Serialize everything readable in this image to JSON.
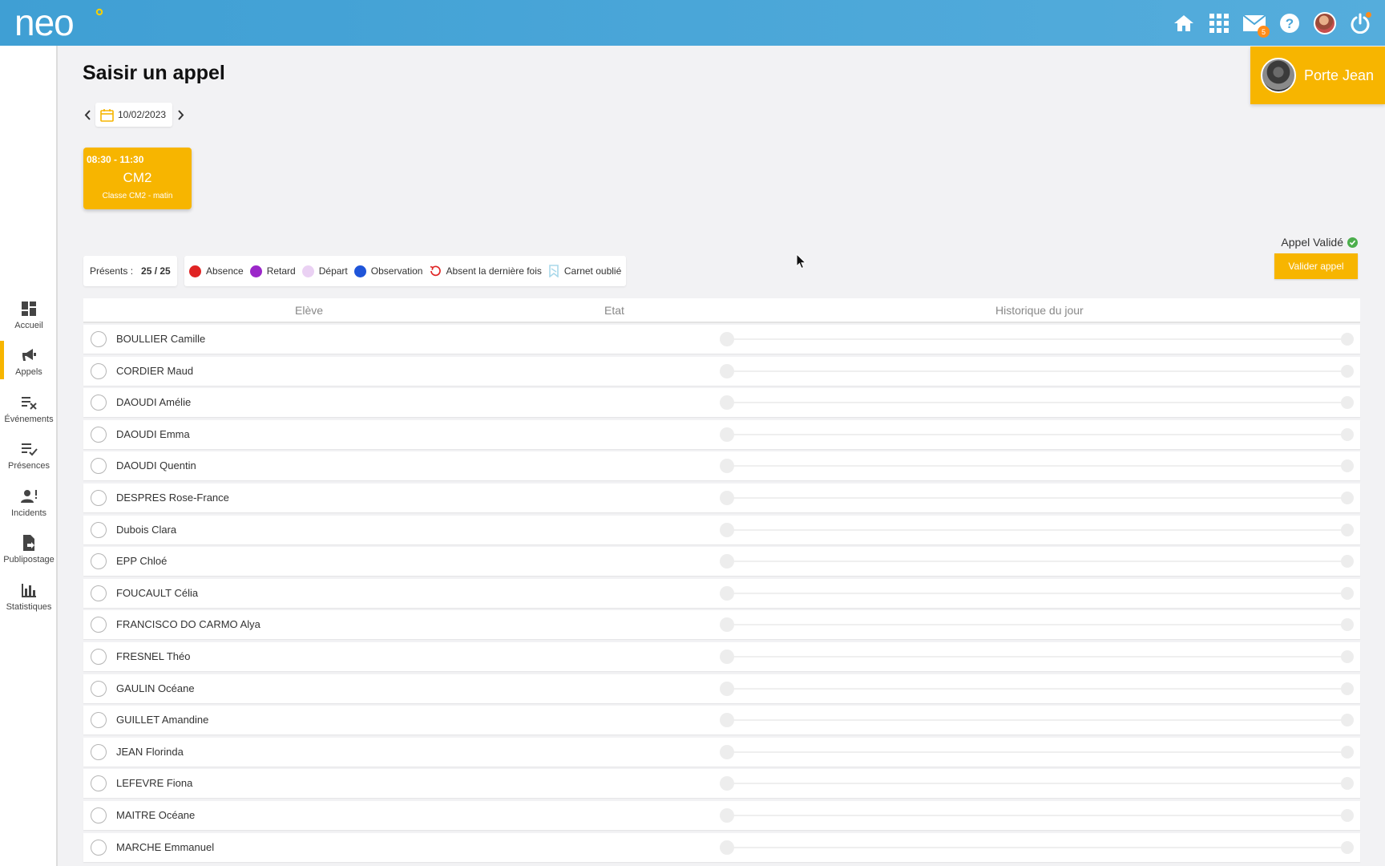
{
  "header": {
    "logo_text": "neo",
    "mail_badge": "5",
    "icons": [
      "home-icon",
      "apps-grid-icon",
      "mail-icon",
      "help-icon",
      "user-avatar",
      "power-icon"
    ]
  },
  "user": {
    "name": "Porte Jean"
  },
  "sidebar": {
    "items": [
      {
        "label": "Accueil",
        "icon": "dashboard-icon"
      },
      {
        "label": "Appels",
        "icon": "megaphone-icon"
      },
      {
        "label": "Événements",
        "icon": "list-x-icon"
      },
      {
        "label": "Présences",
        "icon": "list-check-icon"
      },
      {
        "label": "Incidents",
        "icon": "person-alert-icon"
      },
      {
        "label": "Publipostage",
        "icon": "document-arrow-icon"
      },
      {
        "label": "Statistiques",
        "icon": "bar-chart-icon"
      }
    ],
    "active": "Appels"
  },
  "page": {
    "title": "Saisir un appel"
  },
  "date": {
    "value": "10/02/2023"
  },
  "course": {
    "time": "08:30 - 11:30",
    "name": "CM2",
    "subtitle": "Classe CM2 - matin"
  },
  "status": {
    "label": "Appel Validé",
    "button": "Valider appel"
  },
  "counter": {
    "label": "Présents :",
    "value": "25 / 25"
  },
  "legend": [
    {
      "label": "Absence",
      "color": "#e02424",
      "kind": "dot"
    },
    {
      "label": "Retard",
      "color": "#9b27c9",
      "kind": "dot"
    },
    {
      "label": "Départ",
      "color": "#ead1f3",
      "kind": "dot"
    },
    {
      "label": "Observation",
      "color": "#1f55d9",
      "kind": "dot"
    },
    {
      "label": "Absent la dernière fois",
      "color": "#e02424",
      "kind": "history-icon"
    },
    {
      "label": "Carnet oublié",
      "color": "#a9d8ea",
      "kind": "bookmark-icon"
    }
  ],
  "table": {
    "columns": [
      "Elève",
      "Etat",
      "Historique du jour"
    ],
    "students": [
      "BOULLIER Camille",
      "CORDIER Maud",
      "DAOUDI Amélie",
      "DAOUDI Emma",
      "DAOUDI Quentin",
      "DESPRES Rose-France",
      "Dubois Clara",
      "EPP Chloé",
      "FOUCAULT Célia",
      "FRANCISCO DO CARMO Alya",
      "FRESNEL Théo",
      "GAULIN Océane",
      "GUILLET Amandine",
      "JEAN Florinda",
      "LEFEVRE Fiona",
      "MAITRE Océane",
      "MARCHE Emmanuel"
    ]
  },
  "colors": {
    "accent": "#f7b500",
    "header": "#4aa6d8",
    "valid": "#4cae4c"
  }
}
